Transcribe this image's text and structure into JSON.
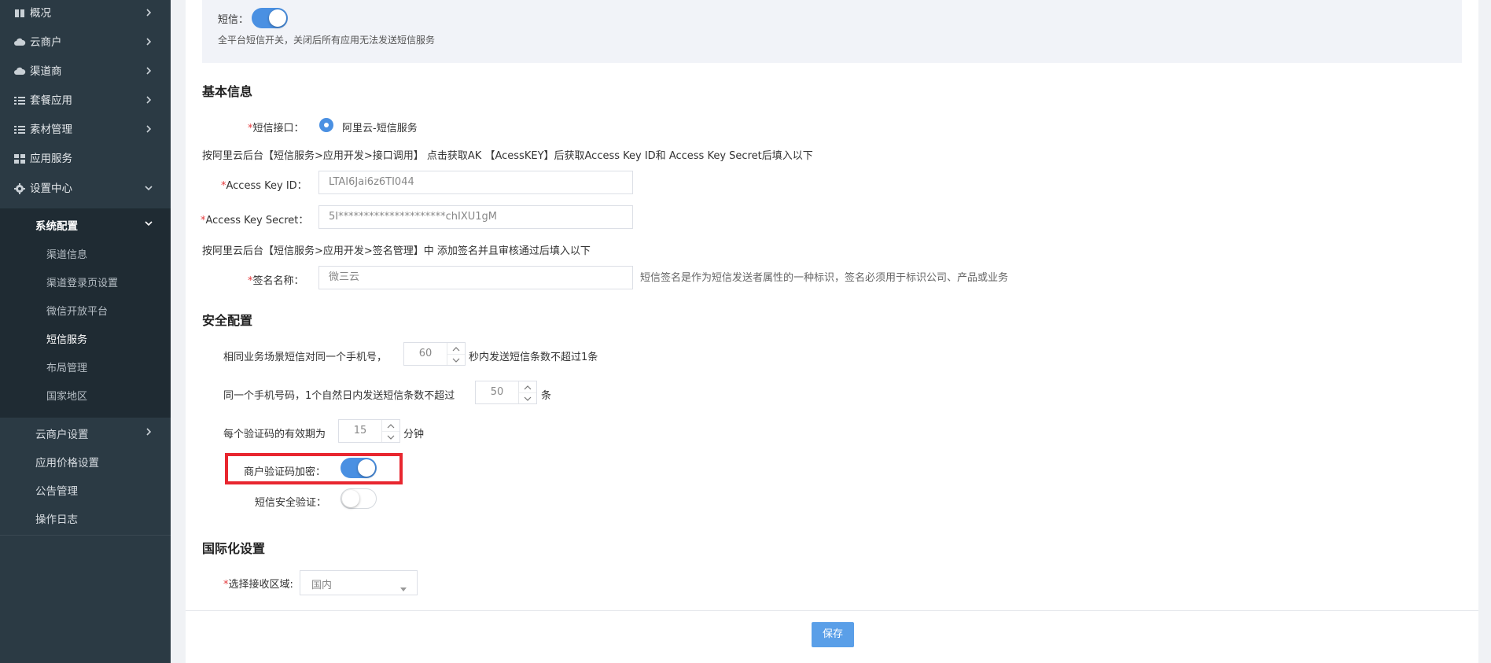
{
  "sidebar": {
    "items": [
      {
        "label": "概况",
        "icon": "book-icon"
      },
      {
        "label": "云商户",
        "icon": "cloud-icon"
      },
      {
        "label": "渠道商",
        "icon": "cloud-icon"
      },
      {
        "label": "套餐应用",
        "icon": "list-icon"
      },
      {
        "label": "素材管理",
        "icon": "list-icon"
      },
      {
        "label": "应用服务",
        "icon": "grid-icon"
      },
      {
        "label": "设置中心",
        "icon": "gear-icon"
      }
    ],
    "group_title": "系统配置",
    "sub_items": [
      "渠道信息",
      "渠道登录页设置",
      "微信开放平台",
      "短信服务",
      "布局管理",
      "国家地区"
    ],
    "active_sub": "短信服务",
    "more_items": [
      "云商户设置",
      "应用价格设置",
      "公告管理",
      "操作日志"
    ]
  },
  "top": {
    "sms_label": "短信：",
    "sms_enabled": true,
    "sms_hint": "全平台短信开关，关闭后所有应用无法发送短信服务"
  },
  "basic": {
    "title": "基本信息",
    "interface_label": "短信接口：",
    "interface_option": "阿里云-短信服务",
    "instruction1": "按阿里云后台【短信服务>应用开发>接口调用】 点击获取AK 【AcessKEY】后获取Access Key ID和 Access Key Secret后填入以下",
    "key_id_label": "Access Key ID：",
    "key_id_value": "LTAI6Jai6z6TI044",
    "key_secret_label": "Access Key Secret：",
    "key_secret_value": "5I*********************chIXU1gM",
    "instruction2": "按阿里云后台【短信服务>应用开发>签名管理】中 添加签名并且审核通过后填入以下",
    "sign_label": "签名名称：",
    "sign_value": "微三云",
    "sign_hint": "短信签名是作为短信发送者属性的一种标识，签名必须用于标识公司、产品或业务"
  },
  "security": {
    "title": "安全配置",
    "rule1_prefix": "相同业务场景短信对同一个手机号，",
    "rule1_value": "60",
    "rule1_suffix": "秒内发送短信条数不超过1条",
    "rule2_prefix": "同一个手机号码，1个自然日内发送短信条数不超过",
    "rule2_value": "50",
    "rule2_suffix": "条",
    "rule3_prefix": "每个验证码的有效期为",
    "rule3_value": "15",
    "rule3_suffix": "分钟",
    "encrypt_label": "商户验证码加密：",
    "encrypt_enabled": true,
    "verify_label": "短信安全验证：",
    "verify_enabled": false
  },
  "i18n": {
    "title": "国际化设置",
    "region_label": "选择接收区域:",
    "region_value": "国内"
  },
  "footer": {
    "save_label": "保存"
  },
  "colors": {
    "sidebar_bg": "#2b3a44",
    "accent": "#4a90e2",
    "highlight": "#e8262f",
    "required": "#e4393c"
  }
}
